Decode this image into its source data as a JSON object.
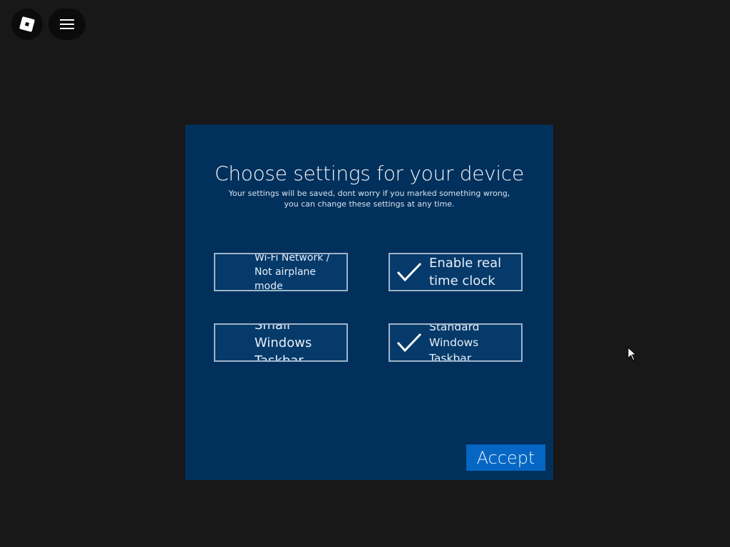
{
  "topbar": {
    "logo_icon": "roblox-logo-icon",
    "menu_icon": "hamburger-menu-icon"
  },
  "dialog": {
    "title": "Choose settings for your device",
    "subtitle": "Your settings will be saved, dont worry if you marked something wrong, you can change these settings at any time.",
    "options": [
      {
        "label": "Wi-Fi Network / Not airplane mode",
        "checked": false
      },
      {
        "label": "Enable real time clock",
        "checked": true
      },
      {
        "label": "Small Windows Taskbar",
        "checked": false
      },
      {
        "label": "Standard Windows Taskbar",
        "checked": true
      }
    ],
    "accept_label": "Accept"
  },
  "colors": {
    "background": "#181818",
    "dialog": "#01305c",
    "accent": "#0566c4",
    "border": "#9fb4c9"
  }
}
